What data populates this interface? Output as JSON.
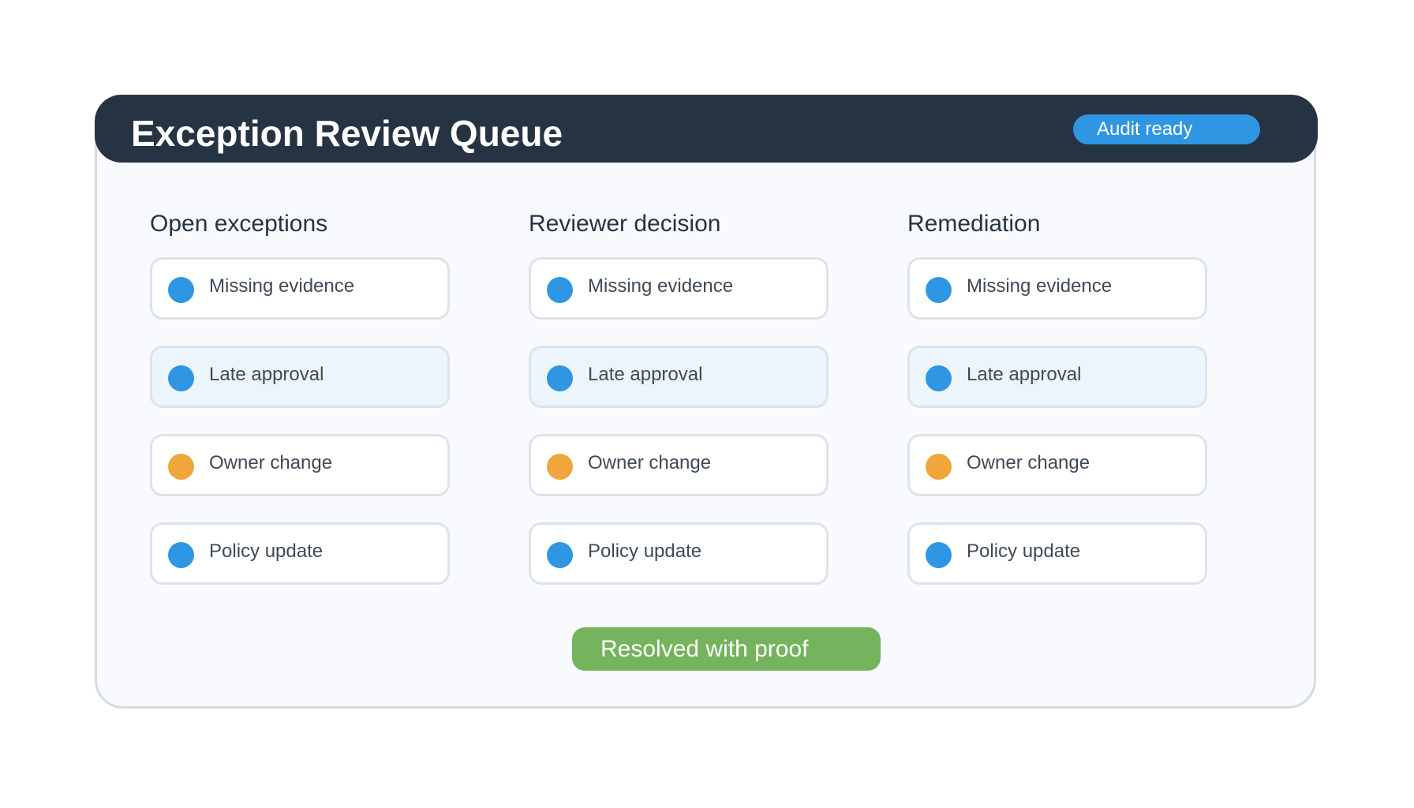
{
  "header": {
    "title": "Exception Review Queue",
    "badge": "Audit ready"
  },
  "colors": {
    "header_bg": "#263342",
    "badge_blue": "#2f96e3",
    "dot_blue": "#2f96e3",
    "dot_orange": "#f0a63c",
    "cta_green": "#75b45d",
    "highlight_bg": "#edf5fc"
  },
  "columns": [
    {
      "title": "Open exceptions",
      "items": [
        {
          "label": "Missing evidence",
          "status": "blue",
          "highlighted": false
        },
        {
          "label": "Late approval",
          "status": "blue",
          "highlighted": true
        },
        {
          "label": "Owner change",
          "status": "orange",
          "highlighted": false
        },
        {
          "label": "Policy update",
          "status": "blue",
          "highlighted": false
        }
      ]
    },
    {
      "title": "Reviewer decision",
      "items": [
        {
          "label": "Missing evidence",
          "status": "blue",
          "highlighted": false
        },
        {
          "label": "Late approval",
          "status": "blue",
          "highlighted": true
        },
        {
          "label": "Owner change",
          "status": "orange",
          "highlighted": false
        },
        {
          "label": "Policy update",
          "status": "blue",
          "highlighted": false
        }
      ]
    },
    {
      "title": "Remediation",
      "items": [
        {
          "label": "Missing evidence",
          "status": "blue",
          "highlighted": false
        },
        {
          "label": "Late approval",
          "status": "blue",
          "highlighted": true
        },
        {
          "label": "Owner change",
          "status": "orange",
          "highlighted": false
        },
        {
          "label": "Policy update",
          "status": "blue",
          "highlighted": false
        }
      ]
    }
  ],
  "footer": {
    "cta_label": "Resolved with proof"
  }
}
